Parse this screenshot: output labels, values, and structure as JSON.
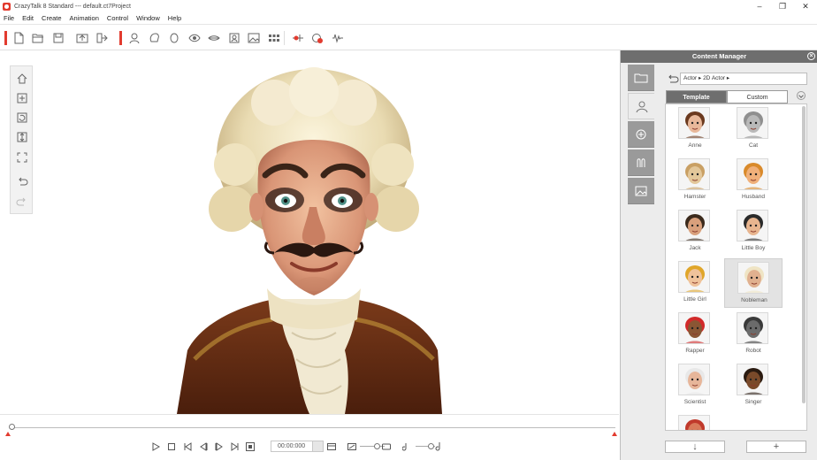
{
  "window": {
    "title": "CrazyTalk 8 Standard --- default.ct7Project",
    "minimize": "–",
    "maximize": "❐",
    "close": "✕"
  },
  "menu": [
    "File",
    "Edit",
    "Create",
    "Animation",
    "Control",
    "Window",
    "Help"
  ],
  "timeline": {
    "timecode": "00:00:000"
  },
  "content_manager": {
    "title": "Content Manager",
    "breadcrumb": [
      "Actor",
      "2D Actor"
    ],
    "tabs": {
      "template": "Template",
      "custom": "Custom"
    },
    "items": [
      {
        "label": "Anne",
        "skin": "#e8b89a",
        "hair": "#6b3a1f"
      },
      {
        "label": "Cat",
        "skin": "#b9b9b9",
        "hair": "#8f8f8f"
      },
      {
        "label": "Hamster",
        "skin": "#e3c79a",
        "hair": "#c9a064"
      },
      {
        "label": "Husband",
        "skin": "#f0b07a",
        "hair": "#d98a2b"
      },
      {
        "label": "Jack",
        "skin": "#d9a07c",
        "hair": "#3b2a1c"
      },
      {
        "label": "Little Boy",
        "skin": "#e8b58f",
        "hair": "#2a2a2a"
      },
      {
        "label": "Little Girl",
        "skin": "#f0c39b",
        "hair": "#e0a62a"
      },
      {
        "label": "Nobleman",
        "skin": "#e0b08f",
        "hair": "#efe4c4"
      },
      {
        "label": "Rapper",
        "skin": "#8a5634",
        "hair": "#d12a2a"
      },
      {
        "label": "Robot",
        "skin": "#6b6b6b",
        "hair": "#3a3a3a"
      },
      {
        "label": "Scientist",
        "skin": "#e7b69a",
        "hair": "#e8e8e8"
      },
      {
        "label": "Singer",
        "skin": "#7a4a2a",
        "hair": "#2a1a10"
      },
      {
        "label": "",
        "skin": "#d97a5a",
        "hair": "#c0392b"
      }
    ],
    "selected": "Nobleman",
    "bottom": {
      "down_label": "↓",
      "add_label": "+"
    }
  },
  "colors": {
    "accent": "#e23b2f",
    "panel_header": "#6e6e6e"
  },
  "icons": {
    "toolbar": [
      "new-project-icon",
      "open-project-icon",
      "save-project-icon",
      "import-image-icon",
      "export-icon",
      "face-fitting-icon",
      "head-tool-icon",
      "face-orientation-icon",
      "eye-settings-icon",
      "mouth-settings-icon",
      "background-mask-icon",
      "image-editor-icon",
      "face-profile-icon",
      "timeline-icon",
      "record-icon",
      "audio-icon"
    ],
    "left_tools": [
      "home-icon",
      "zoom-fit-icon",
      "reset-view-icon",
      "frame-height-icon",
      "fullscreen-icon",
      "undo-icon",
      "redo-icon"
    ]
  }
}
